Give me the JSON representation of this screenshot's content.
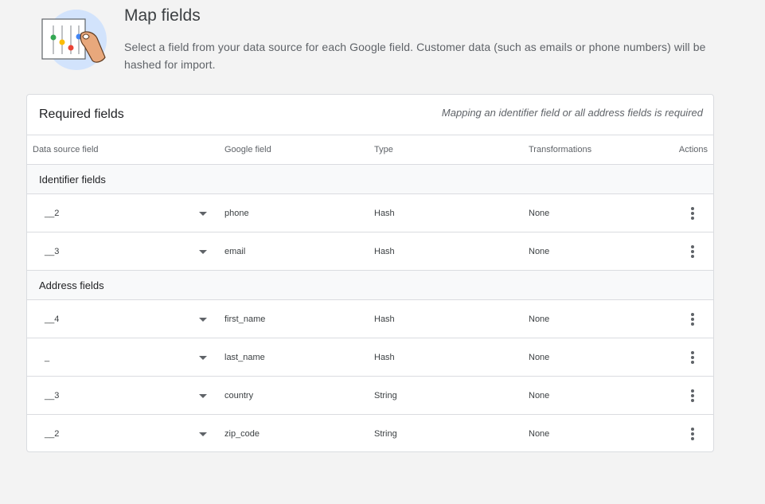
{
  "header": {
    "title": "Map fields",
    "description": "Select a field from your data source for each Google field. Customer data (such as emails or phone numbers) will be hashed for import.",
    "illustration_icon": "field-mapping-hand-icon"
  },
  "card": {
    "title": "Required fields",
    "note": "Mapping an identifier field or all address fields is required"
  },
  "columns": {
    "source": "Data source field",
    "google": "Google field",
    "type": "Type",
    "transformations": "Transformations",
    "actions": "Actions"
  },
  "sections": [
    {
      "label": "Identifier fields",
      "rows": [
        {
          "source": "__2",
          "google": "phone",
          "type": "Hash",
          "transform": "None"
        },
        {
          "source": "__3",
          "google": "email",
          "type": "Hash",
          "transform": "None"
        }
      ]
    },
    {
      "label": "Address fields",
      "rows": [
        {
          "source": "__4",
          "google": "first_name",
          "type": "Hash",
          "transform": "None"
        },
        {
          "source": "_",
          "google": "last_name",
          "type": "Hash",
          "transform": "None"
        },
        {
          "source": "__3",
          "google": "country",
          "type": "String",
          "transform": "None"
        },
        {
          "source": "__2",
          "google": "zip_code",
          "type": "String",
          "transform": "None"
        }
      ]
    }
  ],
  "icons": {
    "dropdown": "chevron-down-icon",
    "actions": "more-vert-icon"
  },
  "colors": {
    "background": "#f3f3f3",
    "card": "#ffffff",
    "border": "#dadce0",
    "section_bg": "#f8f9fa"
  }
}
